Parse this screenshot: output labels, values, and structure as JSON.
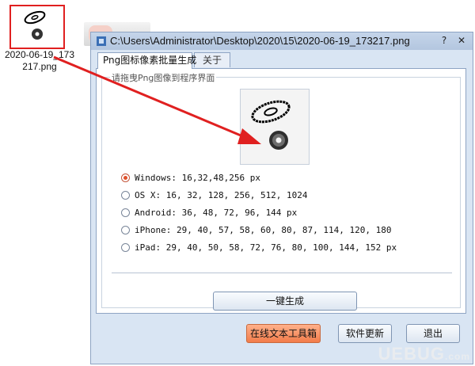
{
  "desktop": {
    "selected_file_label": "2020-06-19_173\n217.png"
  },
  "window": {
    "title": "C:\\Users\\Administrator\\Desktop\\2020\\15\\2020-06-19_173217.png",
    "help_glyph": "?",
    "close_glyph": "✕"
  },
  "tabs": [
    {
      "label": "Png图标像素批量生成"
    },
    {
      "label": "关于"
    }
  ],
  "group": {
    "label": "请拖曳Png图像到程序界面"
  },
  "options": [
    {
      "label": "Windows: 16,32,48,256 px",
      "checked": true
    },
    {
      "label": "OS X: 16, 32, 128, 256, 512, 1024",
      "checked": false
    },
    {
      "label": "Android: 36, 48, 72, 96, 144 px",
      "checked": false
    },
    {
      "label": "iPhone: 29, 40, 57, 58, 60, 80, 87, 114, 120, 180",
      "checked": false
    },
    {
      "label": "iPad: 29, 40, 50, 58, 72, 76, 80, 100, 144, 152 px",
      "checked": false
    }
  ],
  "buttons": {
    "generate": "一键生成",
    "toolbox": "在线文本工具箱",
    "update": "软件更新",
    "exit": "退出"
  },
  "watermark": {
    "text": "UEBUG",
    "suffix": ".com"
  },
  "colors": {
    "accent_red": "#e02020",
    "toolbox_orange": "#f27c4a"
  }
}
